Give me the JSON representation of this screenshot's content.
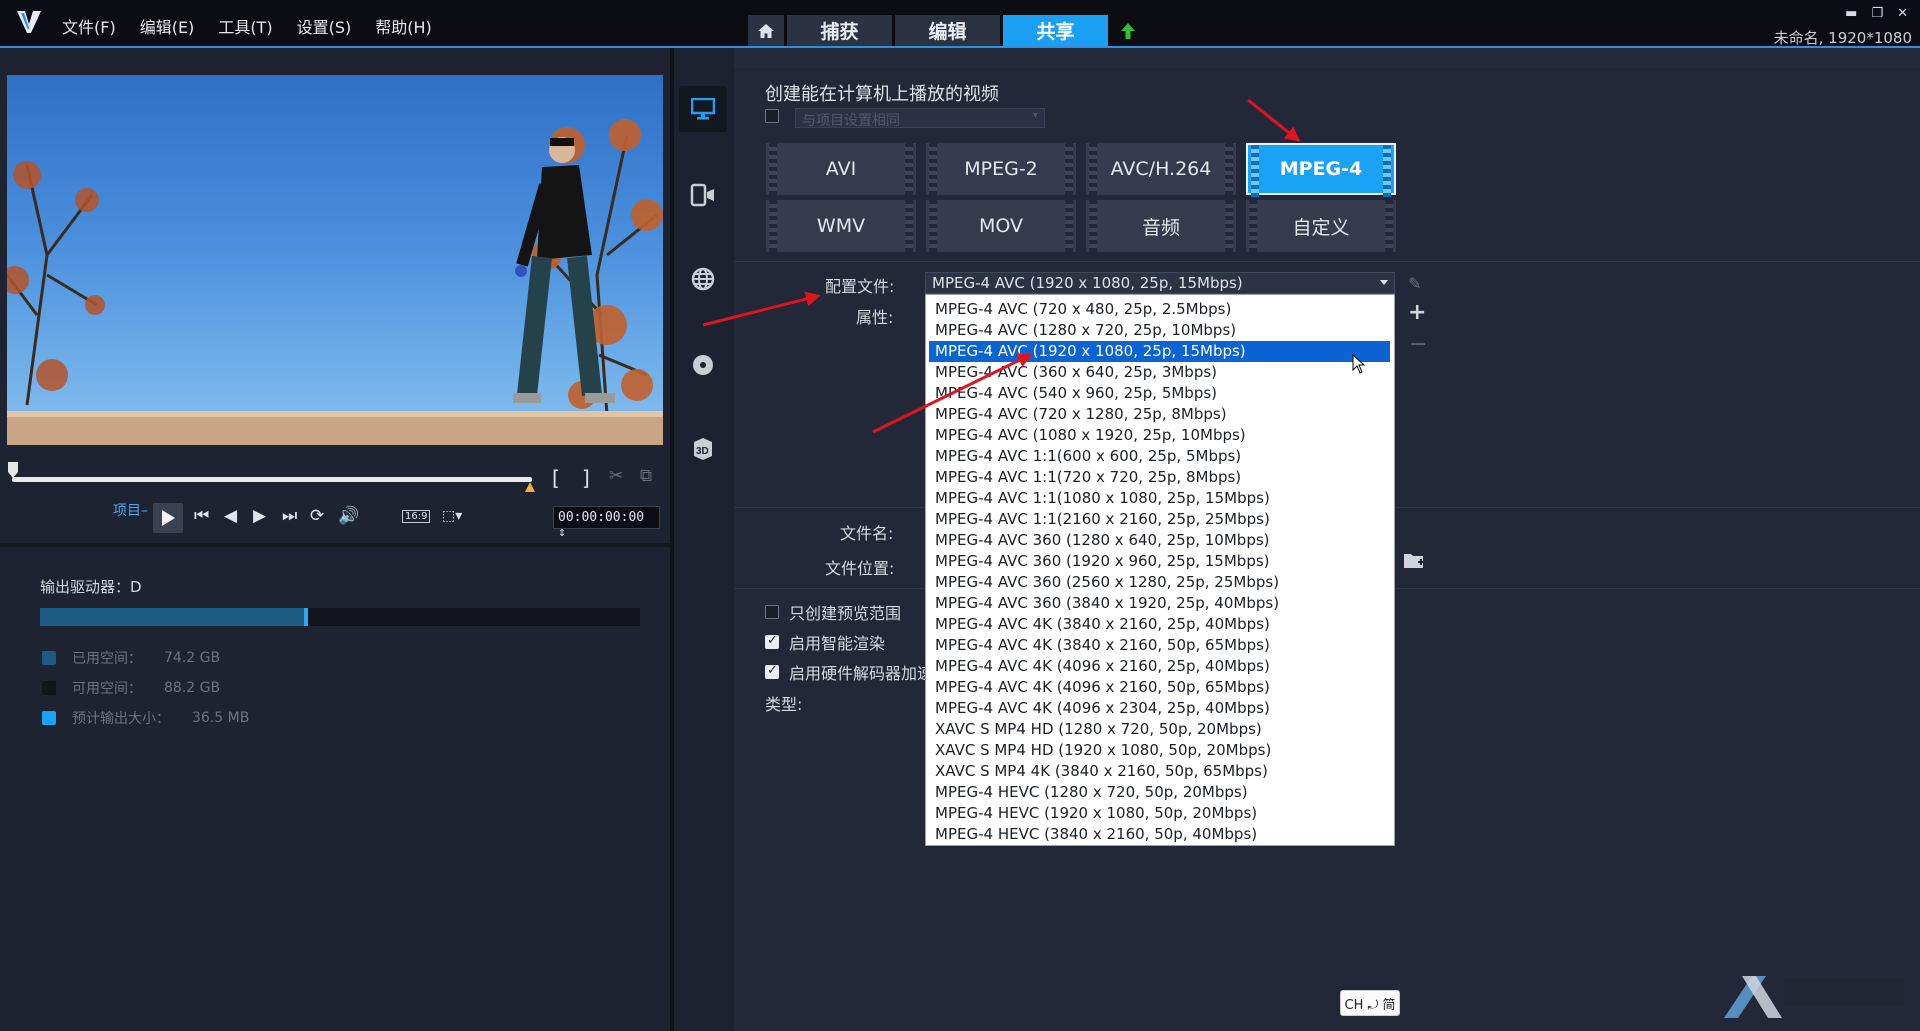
{
  "app": {
    "menu": [
      "文件(F)",
      "编辑(E)",
      "工具(T)",
      "设置(S)",
      "帮助(H)"
    ],
    "tabs": {
      "capture": "捕获",
      "edit": "编辑",
      "share": "共享"
    },
    "project_info": "未命名, 1920*1080"
  },
  "player": {
    "project_label": "项目",
    "aspect": "16:9",
    "timecode": "00:00:00:00"
  },
  "storage": {
    "output_drive": "输出驱动器：D",
    "used_fraction": 0.44,
    "used_label": "已用空间：",
    "used_value": "74.2 GB",
    "free_label": "可用空间：",
    "free_value": "88.2 GB",
    "estimate_label": "预计输出大小：",
    "estimate_value": "36.5 MB",
    "colors": {
      "used": "#1c5b82",
      "free": "#11141b",
      "estimate": "#1aa3f5"
    }
  },
  "share": {
    "heading": "创建能在计算机上播放的视频",
    "same_as_project": "与项目设置相同",
    "formats": [
      "AVI",
      "MPEG-2",
      "AVC/H.264",
      "MPEG-4",
      "WMV",
      "MOV",
      "音频",
      "自定义"
    ],
    "selected_format": "MPEG-4",
    "profile_label": "配置文件:",
    "attributes_label": "属性:",
    "profile_value": "MPEG-4 AVC (1920 x 1080, 25p, 15Mbps)",
    "profiles": [
      "MPEG-4 AVC (720 x 480, 25p, 2.5Mbps)",
      "MPEG-4 AVC (1280 x 720, 25p, 10Mbps)",
      "MPEG-4 AVC (1920 x 1080, 25p, 15Mbps)",
      "MPEG-4 AVC (360 x 640, 25p, 3Mbps)",
      "MPEG-4 AVC (540 x 960, 25p, 5Mbps)",
      "MPEG-4 AVC (720 x 1280, 25p, 8Mbps)",
      "MPEG-4 AVC (1080 x 1920, 25p, 10Mbps)",
      "MPEG-4 AVC 1:1(600 x 600, 25p, 5Mbps)",
      "MPEG-4 AVC 1:1(720 x 720, 25p, 8Mbps)",
      "MPEG-4 AVC 1:1(1080 x 1080, 25p, 15Mbps)",
      "MPEG-4 AVC 1:1(2160 x 2160, 25p, 25Mbps)",
      "MPEG-4 AVC 360 (1280 x 640, 25p, 10Mbps)",
      "MPEG-4 AVC 360 (1920 x 960, 25p, 15Mbps)",
      "MPEG-4 AVC 360 (2560 x 1280, 25p, 25Mbps)",
      "MPEG-4 AVC 360 (3840 x 1920, 25p, 40Mbps)",
      "MPEG-4 AVC 4K (3840 x 2160, 25p, 40Mbps)",
      "MPEG-4 AVC 4K (3840 x 2160, 50p, 65Mbps)",
      "MPEG-4 AVC 4K (4096 x 2160, 25p, 40Mbps)",
      "MPEG-4 AVC 4K (4096 x 2160, 50p, 65Mbps)",
      "MPEG-4 AVC 4K (4096 x 2304, 25p, 40Mbps)",
      "XAVC S MP4 HD (1280 x 720, 50p, 20Mbps)",
      "XAVC S MP4 HD (1920 x 1080, 50p, 20Mbps)",
      "XAVC S MP4 4K (3840 x 2160, 50p, 65Mbps)",
      "MPEG-4 HEVC (1280 x 720, 50p, 20Mbps)",
      "MPEG-4 HEVC (1920 x 1080, 50p, 20Mbps)",
      "MPEG-4 HEVC (3840 x 2160, 50p, 40Mbps)"
    ],
    "selected_profile_index": 2,
    "filename_label": "文件名:",
    "location_label": "文件位置:",
    "options": [
      {
        "label": "只创建预览范围",
        "checked": false
      },
      {
        "label": "启用智能渲染",
        "checked": true
      },
      {
        "label": "启用硬件解码器加速",
        "checked": true
      }
    ],
    "type_label": "类型:"
  },
  "ime": "CH ⤾ 简",
  "annotation_color": "#e0141c"
}
